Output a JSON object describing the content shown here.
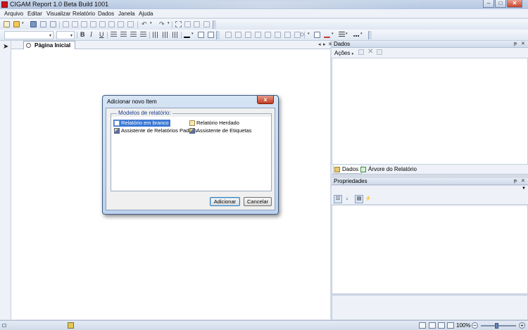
{
  "window": {
    "title": "CIGAM Report 1.0 Beta Build 1001",
    "minimize": "–",
    "maximize": "□",
    "close": "✕"
  },
  "menu": {
    "items": [
      "Arquivo",
      "Editar",
      "Visualizar",
      "Relatório",
      "Dados",
      "Janela",
      "Ajuda"
    ]
  },
  "toolbar2": {
    "bold": "B",
    "italic": "I",
    "underline": "U"
  },
  "document": {
    "tab_label": "Página Inicial",
    "nav_prev": "◂",
    "nav_next": "▸",
    "close": "✕"
  },
  "dados_panel": {
    "title": "Dados",
    "pin": "ᵽ",
    "close": "✕",
    "actions_label": "Ações",
    "tabs": [
      "Dados",
      "Árvore do Relatório"
    ]
  },
  "propriedades_panel": {
    "title": "Propriedades",
    "pin": "ᵽ",
    "close": "✕"
  },
  "status": {
    "zoom": "100%",
    "zoom_out": "−",
    "zoom_in": "+"
  },
  "dialog": {
    "title": "Adicionar novo Item",
    "close": "x",
    "group_label": "Modelos de relatório:",
    "items": [
      "Relatório em branco",
      "Relatório Herdado",
      "Assistente de Relatórios Padrão",
      "Assistente de Etiquetas"
    ],
    "selected_item": "Relatório em branco",
    "add_button": "Adicionar",
    "cancel_button": "Cancelar"
  },
  "colors": {
    "accent": "#3a78d4",
    "title_bar": "#c0d0e6",
    "close_red": "#c43c22"
  }
}
